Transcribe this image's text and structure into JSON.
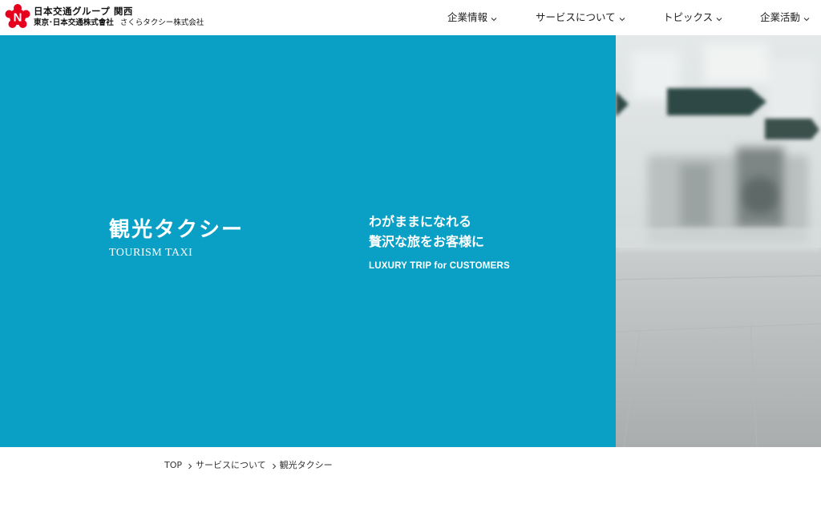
{
  "header": {
    "logo_line1": "日本交通グループ 関西",
    "logo_line2a": "東京･日本交通株式會社",
    "logo_line2b": "さくらタクシー株式会社",
    "logo_mark_letter": "N"
  },
  "nav": {
    "items": [
      {
        "label": "企業情報"
      },
      {
        "label": "サービスについて"
      },
      {
        "label": "トピックス"
      },
      {
        "label": "企業活動"
      }
    ]
  },
  "hero": {
    "title": "観光タクシー",
    "subtitle": "TOURISM TAXI",
    "tagline_line1": "わがままになれる",
    "tagline_line2": "贅沢な旅をお客様に",
    "tagline_en": "LUXURY TRIP for CUSTOMERS"
  },
  "breadcrumb": {
    "items": [
      {
        "label": "TOP"
      },
      {
        "label": "サービスについて"
      },
      {
        "label": "観光タクシー"
      }
    ]
  },
  "colors": {
    "hero_blue": "#0aa0c5",
    "logo_red": "#e6001e",
    "text": "#222222"
  },
  "icons": {
    "nav_chevron": "chevron-down-icon",
    "breadcrumb_separator": "chevron-right-icon",
    "logo": "sakura-n-logo-icon"
  }
}
